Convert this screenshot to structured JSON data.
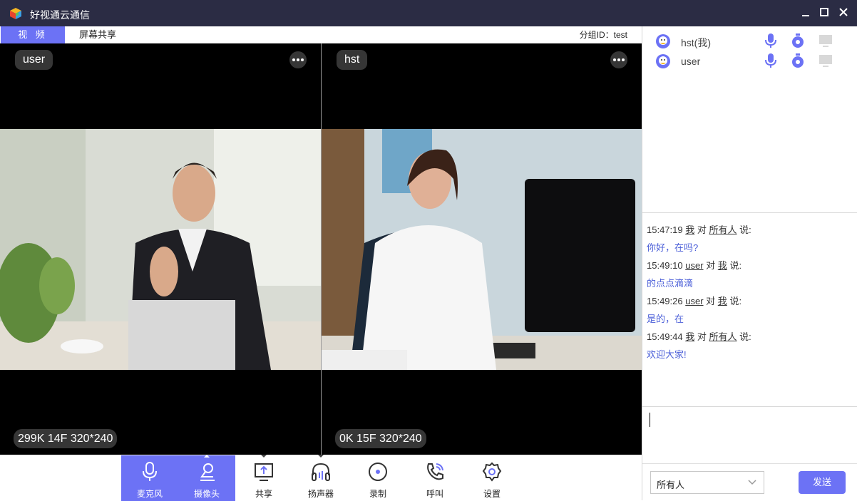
{
  "window": {
    "title": "好视通云通信",
    "controls": [
      "minimize-icon",
      "maximize-icon",
      "close-icon"
    ]
  },
  "tabs": {
    "video": "视 频",
    "screen_share": "屏幕共享",
    "group_id": "分组ID：test"
  },
  "videos": [
    {
      "name": "user",
      "stats": "299K 14F 320*240"
    },
    {
      "name": "hst",
      "stats": "0K 15F 320*240"
    }
  ],
  "toolbar": {
    "items": [
      {
        "label": "麦克风",
        "icon": "microphone-icon",
        "active": true
      },
      {
        "label": "摄像头",
        "icon": "camera-icon",
        "active": true
      },
      {
        "label": "共享",
        "icon": "share-icon",
        "active": false
      },
      {
        "label": "扬声器",
        "icon": "speaker-icon",
        "active": false
      },
      {
        "label": "录制",
        "icon": "record-icon",
        "active": false
      },
      {
        "label": "呼叫",
        "icon": "call-icon",
        "active": false
      },
      {
        "label": "设置",
        "icon": "settings-icon",
        "active": false
      }
    ]
  },
  "members": [
    {
      "name": "hst(我)"
    },
    {
      "name": "user"
    }
  ],
  "chat": {
    "messages": [
      {
        "time": "15:47:19",
        "from": "我",
        "to": "所有人",
        "said": "说:",
        "text": "你好，在吗?"
      },
      {
        "time": "15:49:10",
        "from": "user",
        "to": "我",
        "said": "说:",
        "text": "的点点滴滴"
      },
      {
        "time": "15:49:26",
        "from": "user",
        "to": "我",
        "said": "说:",
        "text": "是的，在"
      },
      {
        "time": "15:49:44",
        "from": "我",
        "to": "所有人",
        "said": "说:",
        "text": "欢迎大家!"
      }
    ],
    "connector": "对",
    "recipient": "所有人",
    "send_label": "发送"
  },
  "colors": {
    "accent": "#6c72f5",
    "titlebar": "#2b2c44",
    "chat_text": "#4a5ed8"
  }
}
